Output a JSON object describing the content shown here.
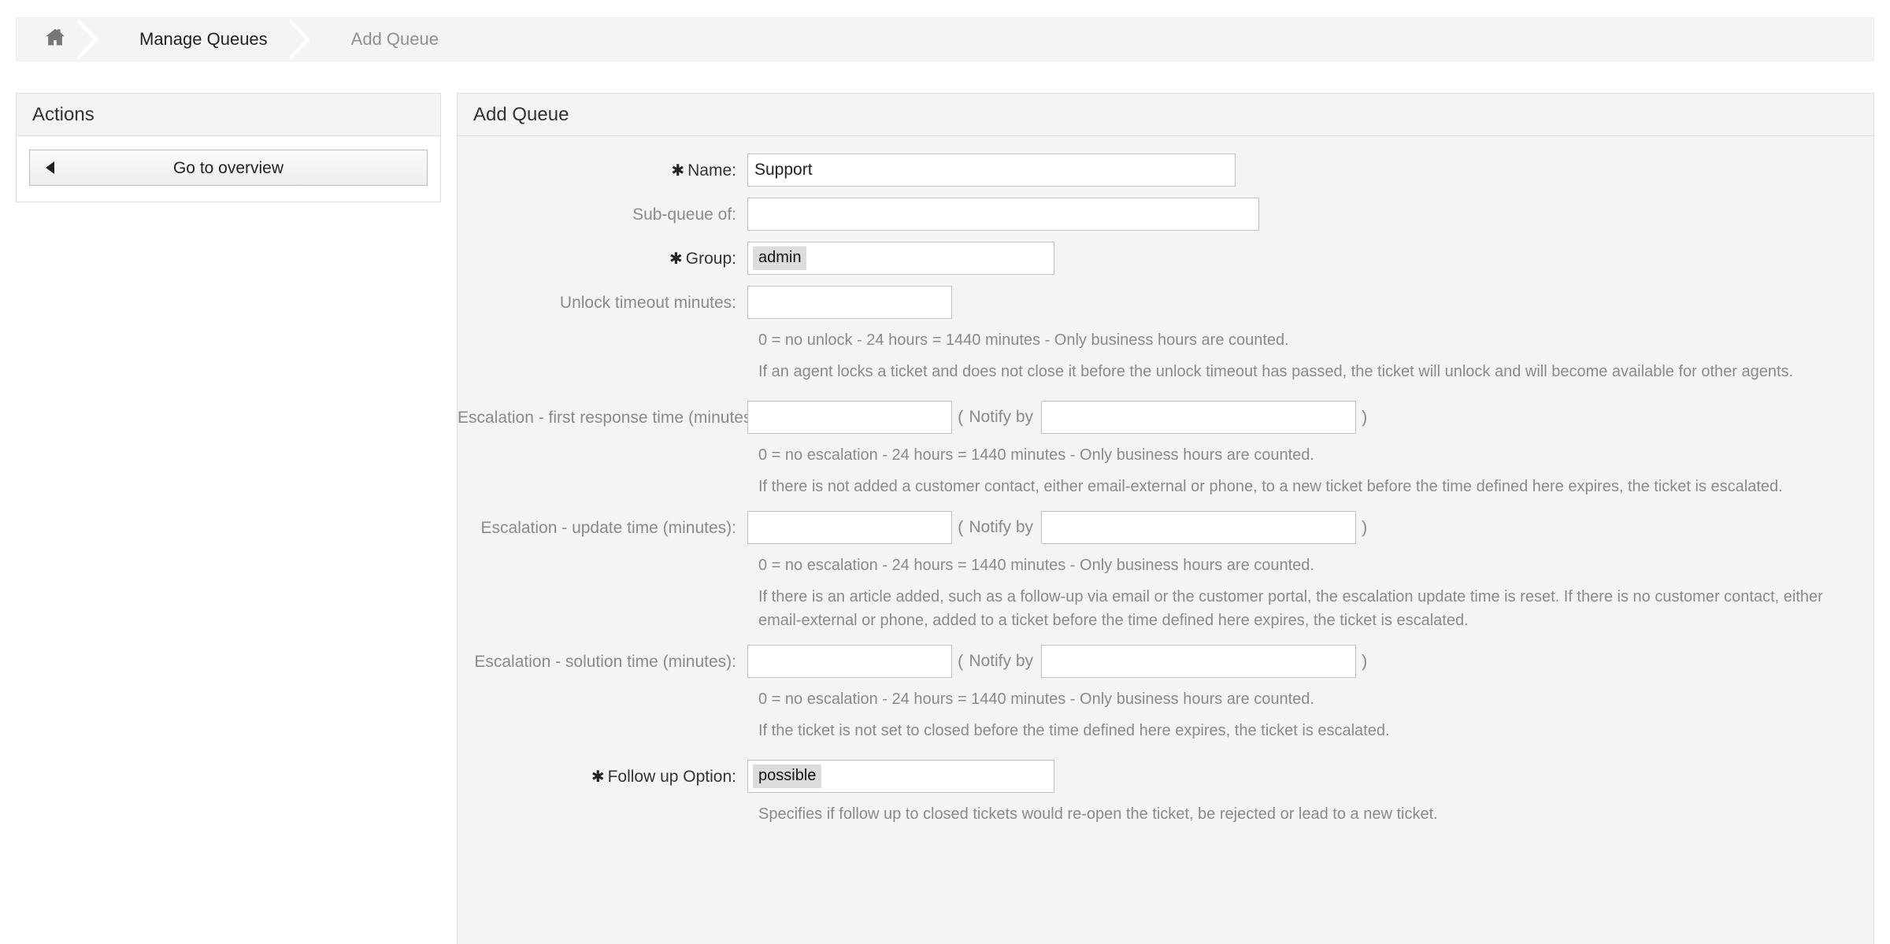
{
  "breadcrumb": {
    "home_icon": "home-icon",
    "items": [
      {
        "label": "Manage Queues",
        "current": false
      },
      {
        "label": "Add Queue",
        "current": true
      }
    ]
  },
  "sidebar": {
    "title": "Actions",
    "overview_button": {
      "label": "Go to overview",
      "icon": "caret-left-icon"
    }
  },
  "main": {
    "title": "Add Queue",
    "fields": {
      "name": {
        "label": "Name:",
        "required_marker": "✱",
        "value": "Support"
      },
      "subqueue": {
        "label": "Sub-queue of:",
        "value": ""
      },
      "group": {
        "label": "Group:",
        "required_marker": "✱",
        "selected": "admin"
      },
      "unlock_timeout": {
        "label": "Unlock timeout minutes:",
        "value": "",
        "hint1": "0 = no unlock - 24 hours = 1440 minutes - Only business hours are counted.",
        "hint2": "If an agent locks a ticket and does not close it before the unlock timeout has passed, the ticket will unlock and will become available for other agents."
      },
      "first_response": {
        "label": "Escalation - first response time (minutes):",
        "value": "",
        "open_paren": "(",
        "notify_label": "Notify by",
        "notify_value": "",
        "close_paren": ")",
        "hint1": "0 = no escalation - 24 hours = 1440 minutes - Only business hours are counted.",
        "hint2": "If there is not added a customer contact, either email-external or phone, to a new ticket before the time defined here expires, the ticket is escalated."
      },
      "update_time": {
        "label": "Escalation - update time (minutes):",
        "value": "",
        "open_paren": "(",
        "notify_label": "Notify by",
        "notify_value": "",
        "close_paren": ")",
        "hint1": "0 = no escalation - 24 hours = 1440 minutes - Only business hours are counted.",
        "hint2": "If there is an article added, such as a follow-up via email or the customer portal, the escalation update time is reset. If there is no customer contact, either email-external or phone, added to a ticket before the time defined here expires, the ticket is escalated."
      },
      "solution_time": {
        "label": "Escalation - solution time (minutes):",
        "value": "",
        "open_paren": "(",
        "notify_label": "Notify by",
        "notify_value": "",
        "close_paren": ")",
        "hint1": "0 = no escalation - 24 hours = 1440 minutes - Only business hours are counted.",
        "hint2": "If the ticket is not set to closed before the time defined here expires, the ticket is escalated."
      },
      "follow_up_option": {
        "label": "Follow up Option:",
        "required_marker": "✱",
        "selected": "possible",
        "hint1": "Specifies if follow up to closed tickets would re-open the ticket, be rejected or lead to a new ticket."
      }
    }
  },
  "colors": {
    "panel_bg": "#f4f4f4",
    "border": "#dddddd",
    "label_muted": "#8a8a8a",
    "text": "#333333",
    "chip_bg": "#dcdcdc"
  }
}
